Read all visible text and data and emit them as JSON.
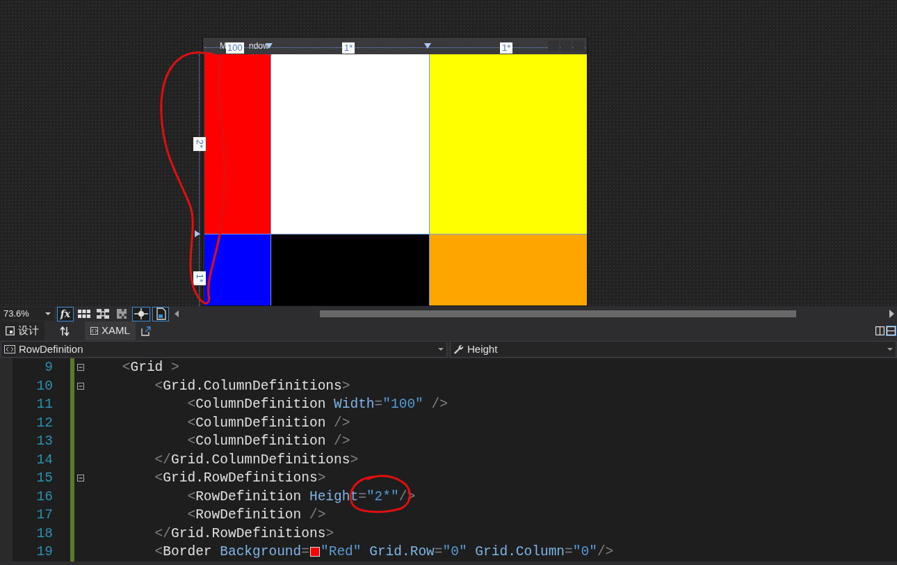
{
  "designer": {
    "title_parts": [
      "M",
      "ndow"
    ],
    "columns": [
      {
        "label": "100"
      },
      {
        "label": "1*"
      },
      {
        "label": "1*"
      }
    ],
    "rows": [
      {
        "label": "2*"
      },
      {
        "label": "1*"
      }
    ],
    "cells": [
      {
        "color": "#ff0000"
      },
      {
        "color": "#ffffff"
      },
      {
        "color": "#ffff00"
      },
      {
        "color": "#0000ff"
      },
      {
        "color": "#000000"
      },
      {
        "color": "#ffa500"
      }
    ]
  },
  "toolbar": {
    "zoom": "73.6%",
    "buttons": [
      {
        "kind": "fx",
        "label": "fx",
        "on": true
      },
      {
        "kind": "grid",
        "on": false
      },
      {
        "kind": "snap",
        "on": false
      },
      {
        "kind": "checker",
        "on": false
      },
      {
        "kind": "snaplines",
        "on": true
      },
      {
        "kind": "effects",
        "on": true
      }
    ]
  },
  "view_tabs": [
    {
      "kind": "design",
      "label": "设计",
      "selected": false
    },
    {
      "kind": "swap"
    },
    {
      "kind": "xaml",
      "label": "XAML",
      "selected": true
    },
    {
      "kind": "popout"
    }
  ],
  "split_buttons": [
    {
      "kind": "vertical",
      "selected": false
    },
    {
      "kind": "horizontal",
      "selected": true
    }
  ],
  "nav": {
    "element": "RowDefinition",
    "member": "Height"
  },
  "code_lines": [
    {
      "number": "9",
      "fold": true,
      "tokens": [
        {
          "kind": "punct",
          "t": "    <"
        },
        {
          "kind": "element",
          "t": "Grid"
        },
        {
          "kind": "punct",
          "t": " >"
        }
      ]
    },
    {
      "number": "10",
      "fold": true,
      "tokens": [
        {
          "kind": "punct",
          "t": "        <"
        },
        {
          "kind": "element",
          "t": "Grid.ColumnDefinitions"
        },
        {
          "kind": "punct",
          "t": ">"
        }
      ]
    },
    {
      "number": "11",
      "fold": false,
      "tokens": [
        {
          "kind": "punct",
          "t": "            <"
        },
        {
          "kind": "element",
          "t": "ColumnDefinition"
        },
        {
          "kind": "attribute",
          "t": " Width"
        },
        {
          "kind": "punct",
          "t": "="
        },
        {
          "kind": "value",
          "t": "\"100\""
        },
        {
          "kind": "punct",
          "t": " />"
        }
      ]
    },
    {
      "number": "12",
      "fold": false,
      "tokens": [
        {
          "kind": "punct",
          "t": "            <"
        },
        {
          "kind": "element",
          "t": "ColumnDefinition"
        },
        {
          "kind": "punct",
          "t": " />"
        }
      ]
    },
    {
      "number": "13",
      "fold": false,
      "tokens": [
        {
          "kind": "punct",
          "t": "            <"
        },
        {
          "kind": "element",
          "t": "ColumnDefinition"
        },
        {
          "kind": "punct",
          "t": " />"
        }
      ]
    },
    {
      "number": "14",
      "fold": false,
      "tokens": [
        {
          "kind": "punct",
          "t": "        </"
        },
        {
          "kind": "element",
          "t": "Grid.ColumnDefinitions"
        },
        {
          "kind": "punct",
          "t": ">"
        }
      ]
    },
    {
      "number": "15",
      "fold": true,
      "tokens": [
        {
          "kind": "punct",
          "t": "        <"
        },
        {
          "kind": "element",
          "t": "Grid.RowDefinitions"
        },
        {
          "kind": "punct",
          "t": ">"
        }
      ]
    },
    {
      "number": "16",
      "fold": false,
      "tokens": [
        {
          "kind": "punct",
          "t": "            <"
        },
        {
          "kind": "element",
          "t": "RowDefinition"
        },
        {
          "kind": "attribute",
          "t": " Height"
        },
        {
          "kind": "punct",
          "t": "="
        },
        {
          "kind": "value",
          "t": "\"2*\""
        },
        {
          "kind": "punct",
          "t": "/>"
        }
      ]
    },
    {
      "number": "17",
      "fold": false,
      "tokens": [
        {
          "kind": "punct",
          "t": "            <"
        },
        {
          "kind": "element",
          "t": "RowDefinition"
        },
        {
          "kind": "punct",
          "t": " />"
        }
      ]
    },
    {
      "number": "18",
      "fold": false,
      "tokens": [
        {
          "kind": "punct",
          "t": "        </"
        },
        {
          "kind": "element",
          "t": "Grid.RowDefinitions"
        },
        {
          "kind": "punct",
          "t": ">"
        }
      ]
    },
    {
      "number": "19",
      "fold": false,
      "tokens": [
        {
          "kind": "punct",
          "t": "        <"
        },
        {
          "kind": "element",
          "t": "Border"
        },
        {
          "kind": "attribute",
          "t": " Background"
        },
        {
          "kind": "punct",
          "t": "="
        },
        {
          "kind": "swatch",
          "color": "#ff0000"
        },
        {
          "kind": "value",
          "t": "\"Red\""
        },
        {
          "kind": "attribute",
          "t": " Grid.Row"
        },
        {
          "kind": "punct",
          "t": "="
        },
        {
          "kind": "value",
          "t": "\"0\""
        },
        {
          "kind": "attribute",
          "t": " Grid.Column"
        },
        {
          "kind": "punct",
          "t": "="
        },
        {
          "kind": "value",
          "t": "\"0\""
        },
        {
          "kind": "punct",
          "t": "/>"
        }
      ]
    }
  ]
}
